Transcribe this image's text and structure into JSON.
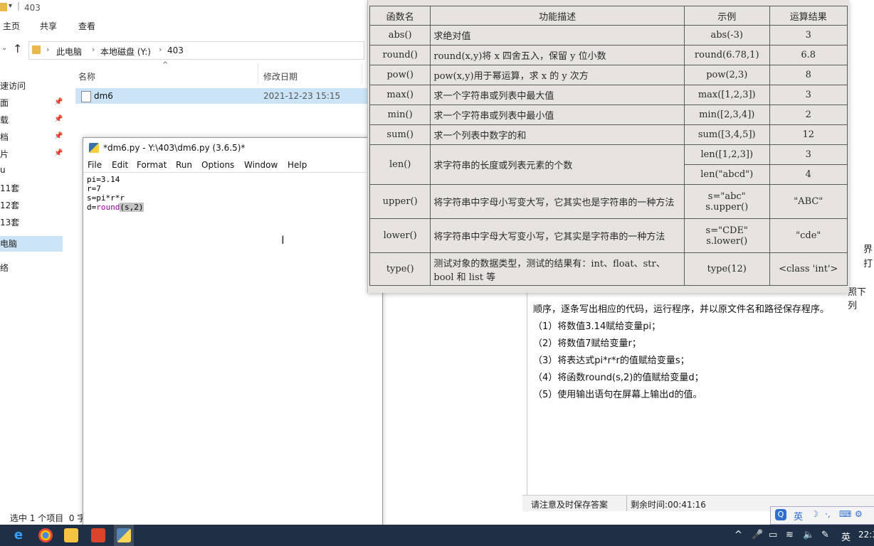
{
  "explorer": {
    "title": "403",
    "ribbon_tabs": [
      "主页",
      "共享",
      "查看"
    ],
    "breadcrumb": [
      "此电脑",
      "本地磁盘 (Y:)",
      "403"
    ],
    "nav_items": [
      "速访问",
      "面",
      "载",
      "档",
      "片",
      "u",
      "11套",
      "12套",
      "13套",
      "电脑",
      "络"
    ],
    "col_name": "名称",
    "col_date": "修改日期",
    "file": {
      "name": "dm6",
      "date": "2021-12-23 15:15"
    },
    "status": "选中 1 个项目  0 字"
  },
  "idle": {
    "title": "*dm6.py - Y:\\403\\dm6.py (3.6.5)*",
    "menu": [
      "File",
      "Edit",
      "Format",
      "Run",
      "Options",
      "Window",
      "Help"
    ],
    "code": {
      "l1": "pi=3.14",
      "l2": "r=7",
      "l3": "s=pi*r*r",
      "l4a": "d=",
      "l4b": "round",
      "l4c": "(s,2)"
    }
  },
  "ref_table": {
    "headers": [
      "函数名",
      "功能描述",
      "示例",
      "运算结果"
    ],
    "rows": [
      {
        "fn": "abs()",
        "desc": "求绝对值",
        "ex": "abs(-3)",
        "res": "3"
      },
      {
        "fn": "round()",
        "desc": "round(x,y)将 x 四舍五入，保留 y 位小数",
        "ex": "round(6.78,1)",
        "res": "6.8"
      },
      {
        "fn": "pow()",
        "desc": "pow(x,y)用于幂运算，求 x 的 y 次方",
        "ex": "pow(2,3)",
        "res": "8"
      },
      {
        "fn": "max()",
        "desc": "求一个字符串或列表中最大值",
        "ex": "max([1,2,3])",
        "res": "3"
      },
      {
        "fn": "min()",
        "desc": "求一个字符串或列表中最小值",
        "ex": "min([2,3,4])",
        "res": "2"
      },
      {
        "fn": "sum()",
        "desc": "求一个列表中数字的和",
        "ex": "sum([3,4,5])",
        "res": "12"
      }
    ],
    "len_row": {
      "fn": "len()",
      "desc": "求字符串的长度或列表元素的个数",
      "ex1": "len([1,2,3])",
      "res1": "3",
      "ex2": "len(\"abcd\")",
      "res2": "4"
    },
    "upper_row": {
      "fn": "upper()",
      "desc": "将字符串中字母小写变大写，它其实也是字符串的一种方法",
      "ex1": "s=\"abc\"",
      "ex2": "s.upper()",
      "res": "\"ABC\""
    },
    "lower_row": {
      "fn": "lower()",
      "desc": "将字符串中字母大写变小写，它其实是字符串的一种方法",
      "ex1": "s=\"CDE\"",
      "ex2": "s.lower()",
      "res": "\"cde\""
    },
    "type_row": {
      "fn": "type()",
      "desc": "测试对象的数据类型，测试的结果有：int、float、str、bool 和 list 等",
      "ex": "type(12)",
      "res": "<class 'int'>"
    }
  },
  "exam": {
    "line0": "照下列",
    "line1": "顺序，逐条写出相应的代码，运行程序，并以原文件名和路径保存程序。",
    "steps": [
      "（1）将数值3.14赋给变量pi；",
      "（2）将数值7赋给变量r；",
      "（3）将表达式pi*r*r的值赋给变量s；",
      "（4）将函数round(s,2)的值赋给变量d；",
      "（5）使用输出语句在屏幕上输出d的值。"
    ],
    "status_left": "请注意及时保存答案",
    "status_right": "剩余时间:00:41:16",
    "side1": "界",
    "side2": "打"
  },
  "ime": {
    "label": "英"
  },
  "taskbar": {
    "lang": "英",
    "clock": "22:3"
  },
  "colors": {
    "taskbar": "#1f2f45",
    "selection": "#cce4f7",
    "builtin": "#900090"
  }
}
